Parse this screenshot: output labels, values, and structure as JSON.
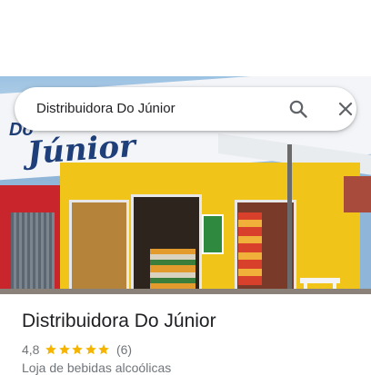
{
  "search": {
    "query": "Distribuidora Do Júnior",
    "search_icon": "search-icon",
    "close_icon": "close-icon"
  },
  "photo": {
    "sign_text_top": "Do",
    "sign_text_bottom": "Júnior"
  },
  "place": {
    "name": "Distribuidora Do Júnior",
    "rating": "4,8",
    "stars": 5,
    "review_count": "(6)",
    "category": "Loja de bebidas alcoólicas"
  },
  "colors": {
    "star": "#f5b400",
    "text_primary": "#202124",
    "text_secondary": "#70757a",
    "icon": "#5f6368"
  }
}
